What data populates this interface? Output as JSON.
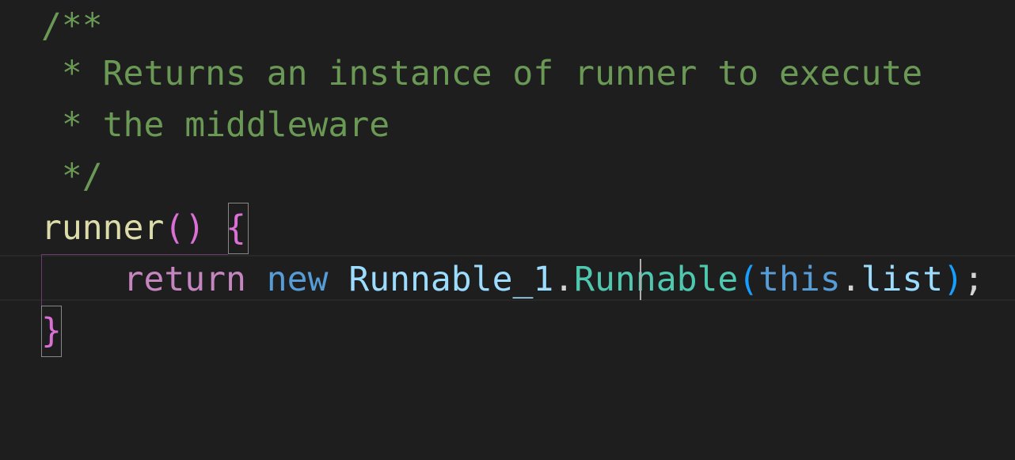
{
  "editor": {
    "language": "typescript",
    "theme_colors": {
      "background": "#1e1e1e",
      "comment": "#6a9955",
      "function": "#dcdcaa",
      "bracket": "#da70d6",
      "keyword": "#c586c0",
      "storage": "#569cd6",
      "identifier": "#9cdcfe",
      "class": "#4ec9b0"
    },
    "lines": [
      {
        "comment": "/**"
      },
      {
        "comment": " * Returns an instance of runner to execute"
      },
      {
        "comment": " * the middleware"
      },
      {
        "comment": " */"
      },
      {
        "func": "runner",
        "parens": "()",
        "space": " ",
        "brace_open": "{"
      },
      {
        "indent": "    ",
        "keyword": "return",
        "new": "new",
        "module": "Runnable_1",
        "dot": ".",
        "class": "Runnable",
        "paren_open": "(",
        "this": "this",
        "dot2": ".",
        "prop": "list",
        "paren_close": ")",
        "semicolon": ";"
      },
      {
        "brace_close": "}"
      }
    ]
  }
}
